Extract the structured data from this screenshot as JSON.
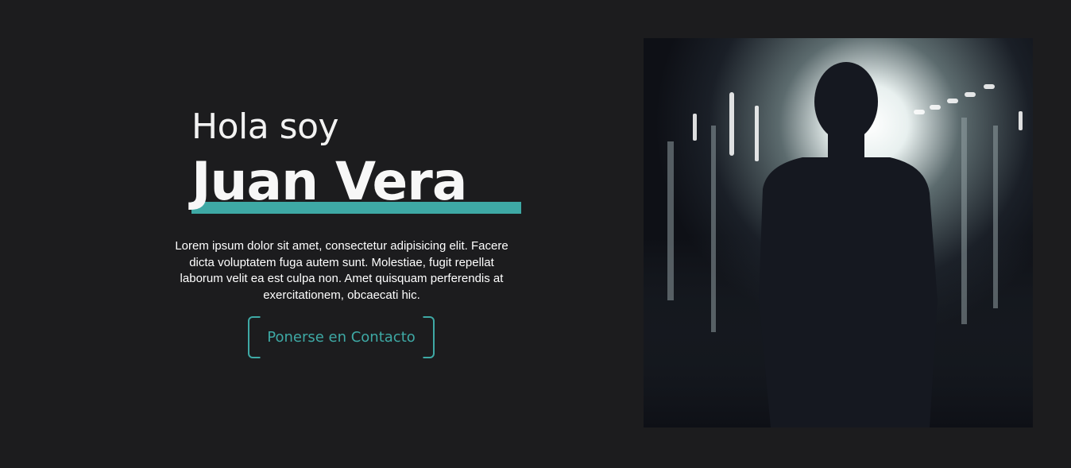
{
  "hero": {
    "greeting": "Hola soy",
    "name": "Juan Vera",
    "bio": "Lorem ipsum dolor sit amet, consectetur adipisicing elit. Facere dicta voluptatem fuga autem sunt. Molestiae, fugit repellat laborum velit ea est culpa non. Amet quisquam perferendis at exercitationem, obcaecati hic.",
    "cta_label": "Ponerse en Contacto"
  },
  "colors": {
    "background": "#1c1c1e",
    "accent": "#3ea9a5",
    "text": "#ffffff"
  },
  "image": {
    "icon": "person-silhouette-corridor-photo"
  }
}
